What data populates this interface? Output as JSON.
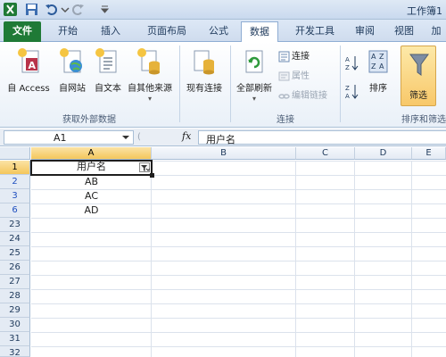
{
  "title_bar": {
    "title": "工作簿1"
  },
  "tabs": [
    "文件",
    "开始",
    "插入",
    "页面布局",
    "公式",
    "数据",
    "开发工具",
    "审阅",
    "视图",
    "加"
  ],
  "ribbon": {
    "get_external": {
      "buttons": [
        "自 Access",
        "自网站",
        "自文本",
        "自其他来源"
      ],
      "label": "获取外部数据"
    },
    "existing_conn": "现有连接",
    "connections": {
      "refresh_all": "全部刷新",
      "connections": "连接",
      "properties": "属性",
      "edit_links": "编辑链接",
      "label": "连接"
    },
    "sort_filter": {
      "sort": "排序",
      "filter": "筛选",
      "label": "排序和筛选"
    }
  },
  "formula_bar": {
    "name_box": "A1",
    "fx": "fx",
    "value": "用户名"
  },
  "columns": [
    "A",
    "B",
    "C",
    "D",
    "E"
  ],
  "rows": [
    {
      "num": "1",
      "a": "用户名"
    },
    {
      "num": "2",
      "a": "AB"
    },
    {
      "num": "3",
      "a": "AC"
    },
    {
      "num": "6",
      "a": "AD"
    },
    {
      "num": "23",
      "a": ""
    },
    {
      "num": "24",
      "a": ""
    },
    {
      "num": "25",
      "a": ""
    },
    {
      "num": "26",
      "a": ""
    },
    {
      "num": "27",
      "a": ""
    },
    {
      "num": "28",
      "a": ""
    },
    {
      "num": "29",
      "a": ""
    },
    {
      "num": "30",
      "a": ""
    },
    {
      "num": "31",
      "a": ""
    },
    {
      "num": "32",
      "a": ""
    }
  ]
}
